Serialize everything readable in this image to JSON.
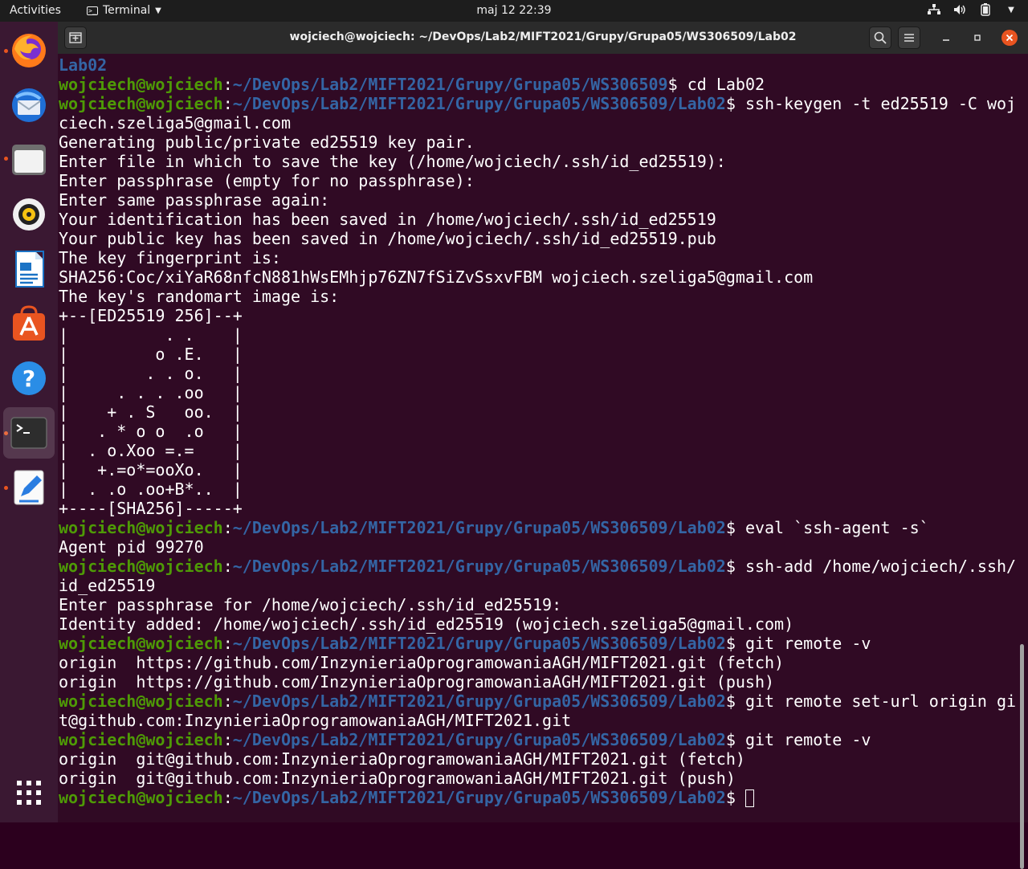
{
  "topbar": {
    "activities": "Activities",
    "app_name": "Terminal",
    "clock": "maj 12  22:39"
  },
  "dock": {
    "items": [
      "firefox-icon",
      "thunderbird-icon",
      "files-icon",
      "rhythmbox-icon",
      "writer-icon",
      "software-icon",
      "help-icon",
      "terminal-icon",
      "text-editor-icon",
      "show-apps-icon"
    ],
    "accent": "#e95420"
  },
  "window": {
    "title": "wojciech@wojciech: ~/DevOps/Lab2/MIFT2021/Grupy/Grupa05/WS306509/Lab02"
  },
  "terminal": {
    "user": "wojciech@wojciech",
    "colors": {
      "background": "#300a24",
      "user": "#4e9a06",
      "path": "#3465a4",
      "text": "#ffffff"
    },
    "lines": [
      {
        "t": "out",
        "text": "Lab02",
        "color": "path"
      },
      {
        "t": "cmd",
        "path": "~/DevOps/Lab2/MIFT2021/Grupy/Grupa05/WS306509",
        "cmd": "cd Lab02"
      },
      {
        "t": "cmd",
        "path": "~/DevOps/Lab2/MIFT2021/Grupy/Grupa05/WS306509/Lab02",
        "cmd": "ssh-keygen -t ed25519 -C woj"
      },
      {
        "t": "out",
        "text": "ciech.szeliga5@gmail.com"
      },
      {
        "t": "out",
        "text": "Generating public/private ed25519 key pair."
      },
      {
        "t": "out",
        "text": "Enter file in which to save the key (/home/wojciech/.ssh/id_ed25519):"
      },
      {
        "t": "out",
        "text": "Enter passphrase (empty for no passphrase):"
      },
      {
        "t": "out",
        "text": "Enter same passphrase again:"
      },
      {
        "t": "out",
        "text": "Your identification has been saved in /home/wojciech/.ssh/id_ed25519"
      },
      {
        "t": "out",
        "text": "Your public key has been saved in /home/wojciech/.ssh/id_ed25519.pub"
      },
      {
        "t": "out",
        "text": "The key fingerprint is:"
      },
      {
        "t": "out",
        "text": "SHA256:Coc/xiYaR68nfcN881hWsEMhjp76ZN7fSiZvSsxvFBM wojciech.szeliga5@gmail.com"
      },
      {
        "t": "out",
        "text": "The key's randomart image is:"
      },
      {
        "t": "out",
        "text": "+--[ED25519 256]--+"
      },
      {
        "t": "out",
        "text": "|          . .    |"
      },
      {
        "t": "out",
        "text": "|         o .E.   |"
      },
      {
        "t": "out",
        "text": "|        . . o.   |"
      },
      {
        "t": "out",
        "text": "|     . . . .oo   |"
      },
      {
        "t": "out",
        "text": "|    + . S   oo.  |"
      },
      {
        "t": "out",
        "text": "|   . * o o  .o   |"
      },
      {
        "t": "out",
        "text": "|  . o.Xoo =.=    |"
      },
      {
        "t": "out",
        "text": "|   +.=o*=ooXo.   |"
      },
      {
        "t": "out",
        "text": "|  . .o .oo+B*..  |"
      },
      {
        "t": "out",
        "text": "+----[SHA256]-----+"
      },
      {
        "t": "cmd",
        "path": "~/DevOps/Lab2/MIFT2021/Grupy/Grupa05/WS306509/Lab02",
        "cmd": "eval `ssh-agent -s`"
      },
      {
        "t": "out",
        "text": "Agent pid 99270"
      },
      {
        "t": "cmd",
        "path": "~/DevOps/Lab2/MIFT2021/Grupy/Grupa05/WS306509/Lab02",
        "cmd": "ssh-add /home/wojciech/.ssh/"
      },
      {
        "t": "out",
        "text": "id_ed25519"
      },
      {
        "t": "out",
        "text": "Enter passphrase for /home/wojciech/.ssh/id_ed25519:"
      },
      {
        "t": "out",
        "text": "Identity added: /home/wojciech/.ssh/id_ed25519 (wojciech.szeliga5@gmail.com)"
      },
      {
        "t": "cmd",
        "path": "~/DevOps/Lab2/MIFT2021/Grupy/Grupa05/WS306509/Lab02",
        "cmd": "git remote -v"
      },
      {
        "t": "out",
        "text": "origin  https://github.com/InzynieriaOprogramowaniaAGH/MIFT2021.git (fetch)"
      },
      {
        "t": "out",
        "text": "origin  https://github.com/InzynieriaOprogramowaniaAGH/MIFT2021.git (push)"
      },
      {
        "t": "cmd",
        "path": "~/DevOps/Lab2/MIFT2021/Grupy/Grupa05/WS306509/Lab02",
        "cmd": "git remote set-url origin gi"
      },
      {
        "t": "out",
        "text": "t@github.com:InzynieriaOprogramowaniaAGH/MIFT2021.git"
      },
      {
        "t": "cmd",
        "path": "~/DevOps/Lab2/MIFT2021/Grupy/Grupa05/WS306509/Lab02",
        "cmd": "git remote -v"
      },
      {
        "t": "out",
        "text": "origin  git@github.com:InzynieriaOprogramowaniaAGH/MIFT2021.git (fetch)"
      },
      {
        "t": "out",
        "text": "origin  git@github.com:InzynieriaOprogramowaniaAGH/MIFT2021.git (push)"
      },
      {
        "t": "prompt",
        "path": "~/DevOps/Lab2/MIFT2021/Grupy/Grupa05/WS306509/Lab02",
        "cmd": ""
      }
    ]
  }
}
